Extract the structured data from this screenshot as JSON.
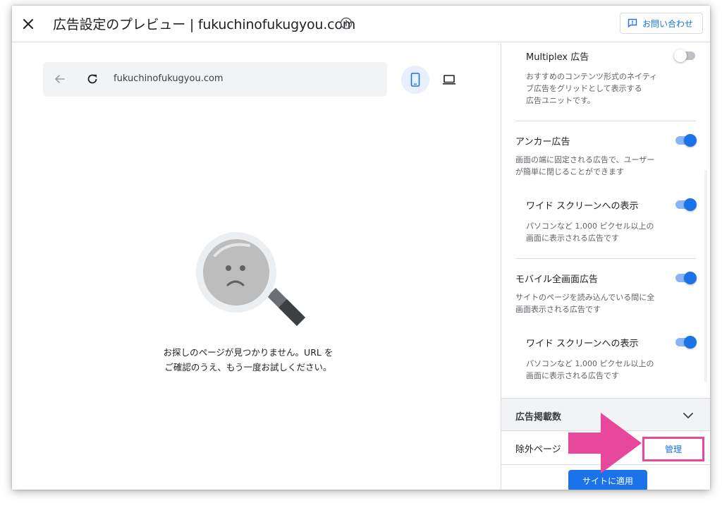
{
  "header": {
    "title": "広告設定のプレビュー | fukuchinofukugyou.com",
    "contact_label": "お問い合わせ"
  },
  "preview": {
    "url": "fukuchinofukugyou.com",
    "message_line1": "お探しのページが見つかりません。URL を",
    "message_line2": "ご確認のうえ、もう一度お試しください。"
  },
  "settings": {
    "multiplex": {
      "title": "Multiplex 広告",
      "desc": [
        "おすすめのコンテンツ形式のネイティ",
        "ブ広告をグリッドとして表示する",
        "広告ユニットです。"
      ],
      "enabled": false
    },
    "anchor": {
      "title": "アンカー広告",
      "desc": [
        "画面の端に固定される広告で、ユーザー",
        "が簡単に閉じることができます"
      ],
      "enabled": true,
      "wide": {
        "title": "ワイド スクリーンへの表示",
        "desc": [
          "パソコンなど 1,000 ピクセル以上の",
          "画面に表示される広告です"
        ],
        "enabled": true
      }
    },
    "vignette": {
      "title": "モバイル全画面広告",
      "desc": [
        "サイトのページを読み込んでいる間に全",
        "画面表示される広告です"
      ],
      "enabled": true,
      "wide": {
        "title": "ワイド スクリーンへの表示",
        "desc": [
          "パソコンなど 1,000 ピクセル以上の",
          "画面に表示される広告です"
        ],
        "enabled": true
      }
    },
    "ad_load_label": "広告掲載数",
    "excluded_label": "除外ページ",
    "manage_label": "管理",
    "apply_label": "サイトに適用"
  },
  "colors": {
    "accent": "#1a73e8",
    "highlight": "#e8489c"
  }
}
